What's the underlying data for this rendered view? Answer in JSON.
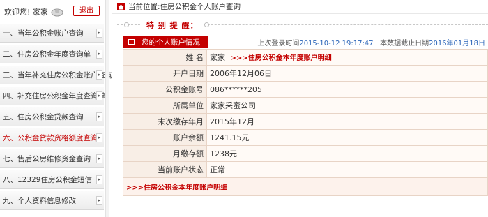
{
  "sidebar": {
    "welcome": "欢迎您! 家家",
    "logout_label": "退出",
    "items": [
      {
        "label": "一、当年公积金账户查询"
      },
      {
        "label": "二、住房公积金年度查询单"
      },
      {
        "label": "三、当年补充住房公积金账户查询"
      },
      {
        "label": "四、补充住房公积金年度查询单"
      },
      {
        "label": "五、住房公积金贷款查询"
      },
      {
        "label": "六、公积金贷款资格额度查询"
      },
      {
        "label": "七、售后公房维修资金查询"
      },
      {
        "label": "八、12329住房公积金短信"
      },
      {
        "label": "九、个人资料信息修改"
      }
    ],
    "active_index": 5,
    "arrow_glyph": "▸"
  },
  "breadcrumb": "当前位置:住房公积金个人账户查询",
  "notice_title": "特 别 提 醒：",
  "info_tab_label": "您的个人账户情况",
  "last_login": {
    "label": "上次登录时间",
    "value": "2015-10-12 19:17:47",
    "cutoff_label": "本数据截止日期",
    "cutoff_value": "2016年01月18日"
  },
  "account": {
    "name_label": "姓 名",
    "name_value": "家家",
    "detail_link": ">>>住房公积金本年度账户明细",
    "open_date_label": "开户日期",
    "open_date_value": "2006年12月06日",
    "account_no_label": "公积金账号",
    "account_no_value": "086******205",
    "employer_label": "所属单位",
    "employer_value": "家家采蜜公司",
    "last_paid_label": "末次缴存年月",
    "last_paid_value": "2015年12月",
    "balance_label": "账户余额",
    "balance_value": "1241.15元",
    "monthly_label": "月缴存额",
    "monthly_value": "1238元",
    "status_label": "当前账户状态",
    "status_value": "正常"
  },
  "bottom_link": ">>>住房公积金本年度账户明细",
  "colors": {
    "accent": "#c40000",
    "link_blue": "#2a64b8"
  },
  "icons": {
    "home": "home-icon",
    "avatar": "user-avatar-icon",
    "tab": "card-icon"
  }
}
